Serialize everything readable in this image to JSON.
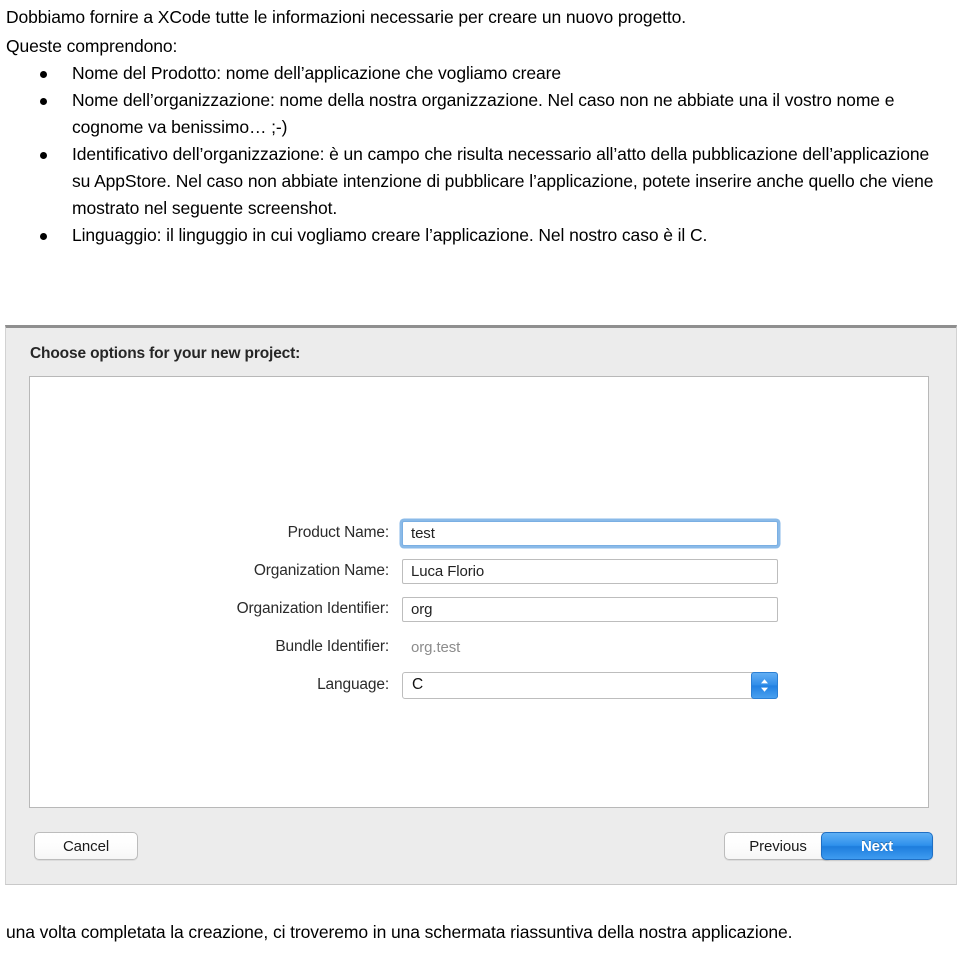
{
  "document": {
    "intro_paragraphs": [
      "Dobbiamo fornire a XCode tutte le informazioni necessarie per creare un nuovo progetto.",
      "Queste comprendono:"
    ],
    "bullets": [
      "Nome del Prodotto: nome dell’applicazione che vogliamo creare",
      "Nome dell’organizzazione: nome della nostra organizzazione. Nel caso non ne abbiate una il vostro nome e cognome va benissimo… ;-)",
      "Identificativo dell’organizzazione: è un campo che risulta necessario all’atto della pubblicazione dell’applicazione su AppStore. Nel caso non abbiate intenzione di pubblicare l’applicazione, potete inserire anche quello che viene mostrato nel seguente screenshot.",
      "Linguaggio: il linguggio in cui vogliamo creare l’applicazione. Nel nostro caso è il C."
    ],
    "closing_paragraph": "una volta completata la creazione, ci troveremo in una schermata riassuntiva della nostra applicazione."
  },
  "dialog": {
    "title": "Choose options for your new project:",
    "fields": [
      {
        "label": "Product Name:",
        "value": "test",
        "type": "text",
        "focused": true
      },
      {
        "label": "Organization Name:",
        "value": "Luca Florio",
        "type": "text",
        "focused": false
      },
      {
        "label": "Organization Identifier:",
        "value": "org",
        "type": "text",
        "focused": false
      },
      {
        "label": "Bundle Identifier:",
        "value": "org.test",
        "type": "static",
        "focused": false
      },
      {
        "label": "Language:",
        "value": "C",
        "type": "select",
        "focused": false
      }
    ],
    "buttons": {
      "cancel": "Cancel",
      "previous": "Previous",
      "next": "Next"
    },
    "colors": {
      "accent_blue": "#2e90ec",
      "focus_ring": "#76aee4",
      "panel_bg": "#ffffff",
      "chrome_bg": "#ececec",
      "static_text": "#8c8c8c"
    },
    "stepper_icon": "chevron-up-down-icon"
  }
}
